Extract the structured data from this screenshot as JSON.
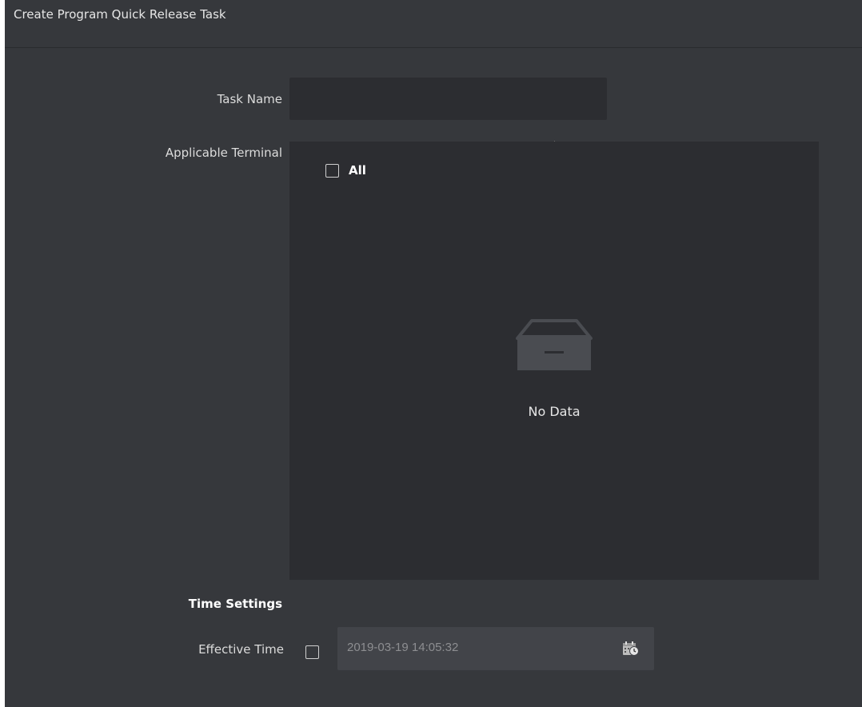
{
  "dialog": {
    "title": "Create Program Quick Release Task"
  },
  "form": {
    "task_name_label": "Task Name",
    "task_name_value": "",
    "applicable_terminal_label": "Applicable Terminal",
    "select_all_label": "All",
    "empty_text": "No Data",
    "time_settings_label": "Time Settings",
    "effective_time_label": "Effective Time",
    "effective_time_value": "2019-03-19 14:05:32"
  },
  "icons": {
    "empty": "empty-box-icon",
    "calendar": "calendar-clock-icon"
  },
  "colors": {
    "background": "#36383c",
    "panel": "#2c2d31",
    "input_disabled": "#424449"
  }
}
